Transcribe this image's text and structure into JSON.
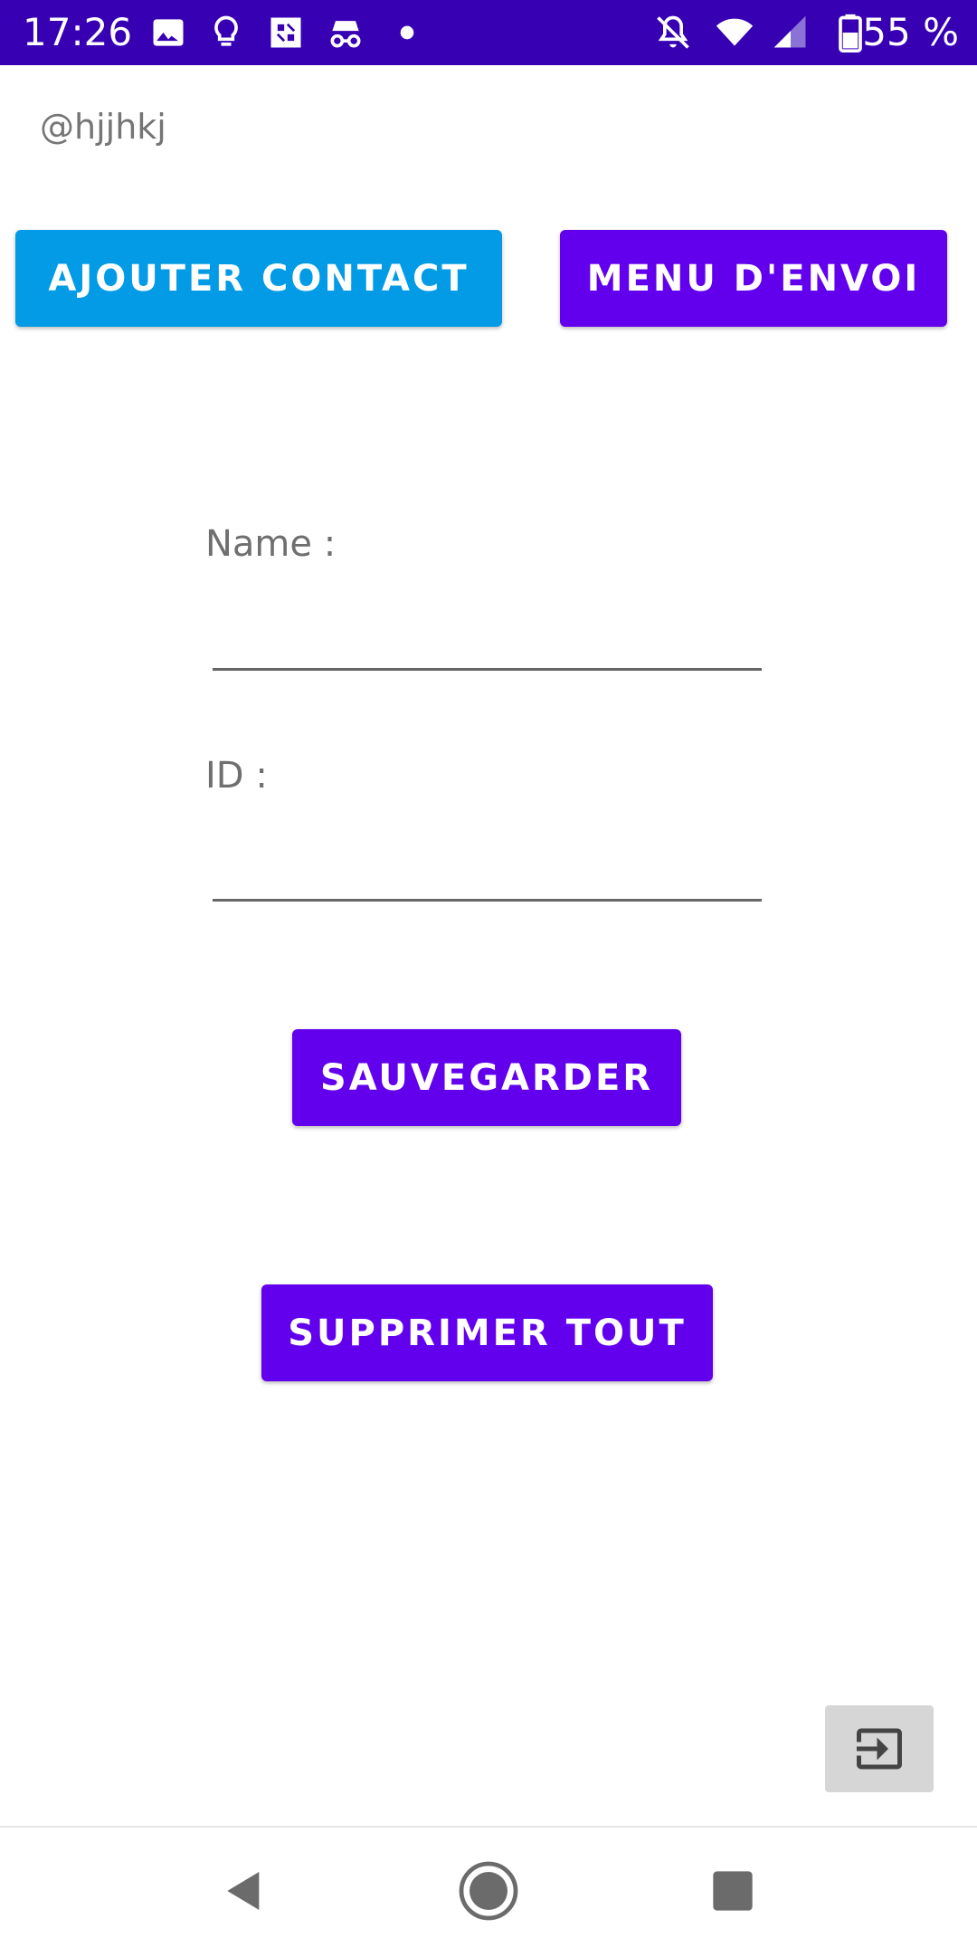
{
  "status_bar": {
    "time": "17:26",
    "battery_text": "55 %",
    "background": "#3700b3",
    "icons": [
      "image-icon",
      "lightbulb-icon",
      "app-icon",
      "incognito-icon",
      "dot-icon",
      "mute-icon",
      "wifi-icon",
      "signal-icon",
      "battery-icon"
    ]
  },
  "header": {
    "handle": "@hjjhkj"
  },
  "top_buttons": {
    "add_contact": "AJOUTER CONTACT",
    "send_menu": "MENU D'ENVOI"
  },
  "form": {
    "name_label": "Name :",
    "name_value": "",
    "id_label": "ID :",
    "id_value": ""
  },
  "actions": {
    "save": "SAUVEGARDER",
    "delete_all": "SUPPRIMER TOUT"
  },
  "exit_button": {
    "icon": "exit-icon"
  },
  "colors": {
    "primary_purple": "#6200ee",
    "accent_blue": "#039be5",
    "status_bar": "#3700b3"
  }
}
